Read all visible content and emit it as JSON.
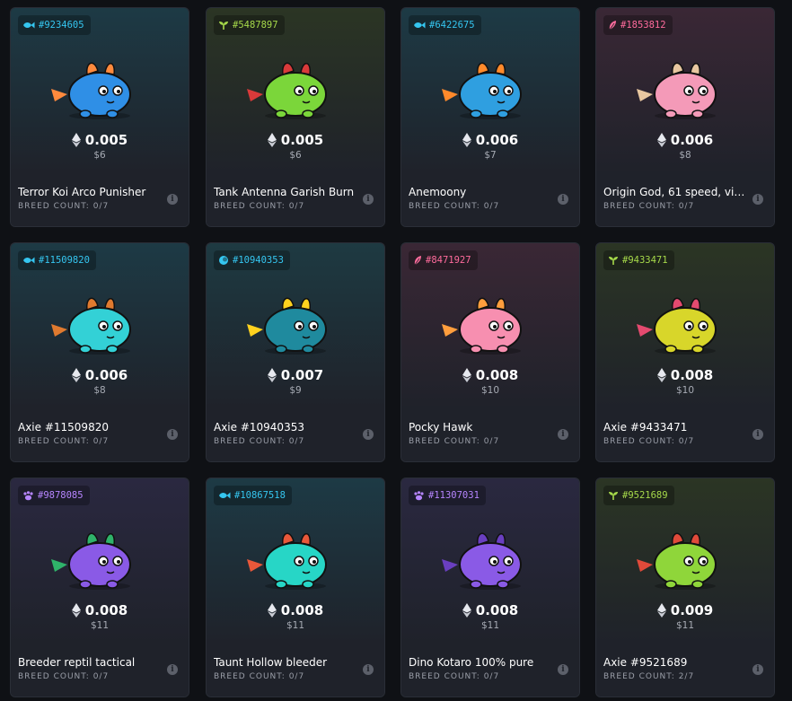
{
  "labels": {
    "breed_prefix": "BREED COUNT:",
    "info_glyph": "i"
  },
  "classes": {
    "aquatic": {
      "color": "#35c6f0",
      "icon": "fish-icon"
    },
    "plant": {
      "color": "#a6d94a",
      "icon": "sprout-icon"
    },
    "bird": {
      "color": "#ff6b9c",
      "icon": "feather-icon"
    },
    "reptile": {
      "color": "#b685ff",
      "icon": "paw-icon"
    },
    "dawn": {
      "color": "#35c6f0",
      "icon": "orb-icon"
    }
  },
  "cards": [
    {
      "id": "#9234605",
      "class": "aquatic",
      "name": "Terror Koi Arco Punisher",
      "price": "0.005",
      "usd": "$6",
      "breed": "0/7",
      "body": "#2f8fe6",
      "accent": "#ff8a3d",
      "top": "#1d3a45"
    },
    {
      "id": "#5487897",
      "class": "plant",
      "name": "Tank Antenna Garish Burn",
      "price": "0.005",
      "usd": "$6",
      "breed": "0/7",
      "body": "#7bd63a",
      "accent": "#d93a3a",
      "top": "#2b3524"
    },
    {
      "id": "#6422675",
      "class": "aquatic",
      "name": "Anemoony",
      "price": "0.006",
      "usd": "$7",
      "breed": "0/7",
      "body": "#2f9fe0",
      "accent": "#ff8a2b",
      "top": "#1d3a45"
    },
    {
      "id": "#1853812",
      "class": "bird",
      "name": "Origin God, 61 speed, vir...",
      "price": "0.006",
      "usd": "$8",
      "breed": "0/7",
      "body": "#f49ab8",
      "accent": "#e8c7a0",
      "top": "#3a2735"
    },
    {
      "id": "#11509820",
      "class": "aquatic",
      "name": "Axie #11509820",
      "price": "0.006",
      "usd": "$8",
      "breed": "0/7",
      "body": "#33d1d6",
      "accent": "#e07a2f",
      "top": "#1d3a45"
    },
    {
      "id": "#10940353",
      "class": "dawn",
      "name": "Axie #10940353",
      "price": "0.007",
      "usd": "$9",
      "breed": "0/7",
      "body": "#1f8a9e",
      "accent": "#ffd21e",
      "top": "#1e3a42"
    },
    {
      "id": "#8471927",
      "class": "bird",
      "name": "Pocky Hawk",
      "price": "0.008",
      "usd": "$10",
      "breed": "0/7",
      "body": "#f78fb0",
      "accent": "#ff9e3d",
      "top": "#3a2735"
    },
    {
      "id": "#9433471",
      "class": "plant",
      "name": "Axie #9433471",
      "price": "0.008",
      "usd": "$10",
      "breed": "0/7",
      "body": "#d8d62a",
      "accent": "#e44a6f",
      "top": "#2b3524"
    },
    {
      "id": "#9878085",
      "class": "reptile",
      "name": "Breeder reptil tactical",
      "price": "0.008",
      "usd": "$11",
      "breed": "0/7",
      "body": "#8a5ae6",
      "accent": "#2fb36a",
      "top": "#2a2840"
    },
    {
      "id": "#10867518",
      "class": "aquatic",
      "name": "Taunt Hollow bleeder",
      "price": "0.008",
      "usd": "$11",
      "breed": "0/7",
      "body": "#27d6c6",
      "accent": "#e8583a",
      "top": "#1d3a45"
    },
    {
      "id": "#11307031",
      "class": "reptile",
      "name": "Dino Kotaro 100% pure",
      "price": "0.008",
      "usd": "$11",
      "breed": "0/7",
      "body": "#8a5ae6",
      "accent": "#6a3fc0",
      "top": "#2a2840"
    },
    {
      "id": "#9521689",
      "class": "plant",
      "name": "Axie #9521689",
      "price": "0.009",
      "usd": "$11",
      "breed": "2/7",
      "body": "#8fd63a",
      "accent": "#e04a3a",
      "top": "#2b3524"
    }
  ]
}
